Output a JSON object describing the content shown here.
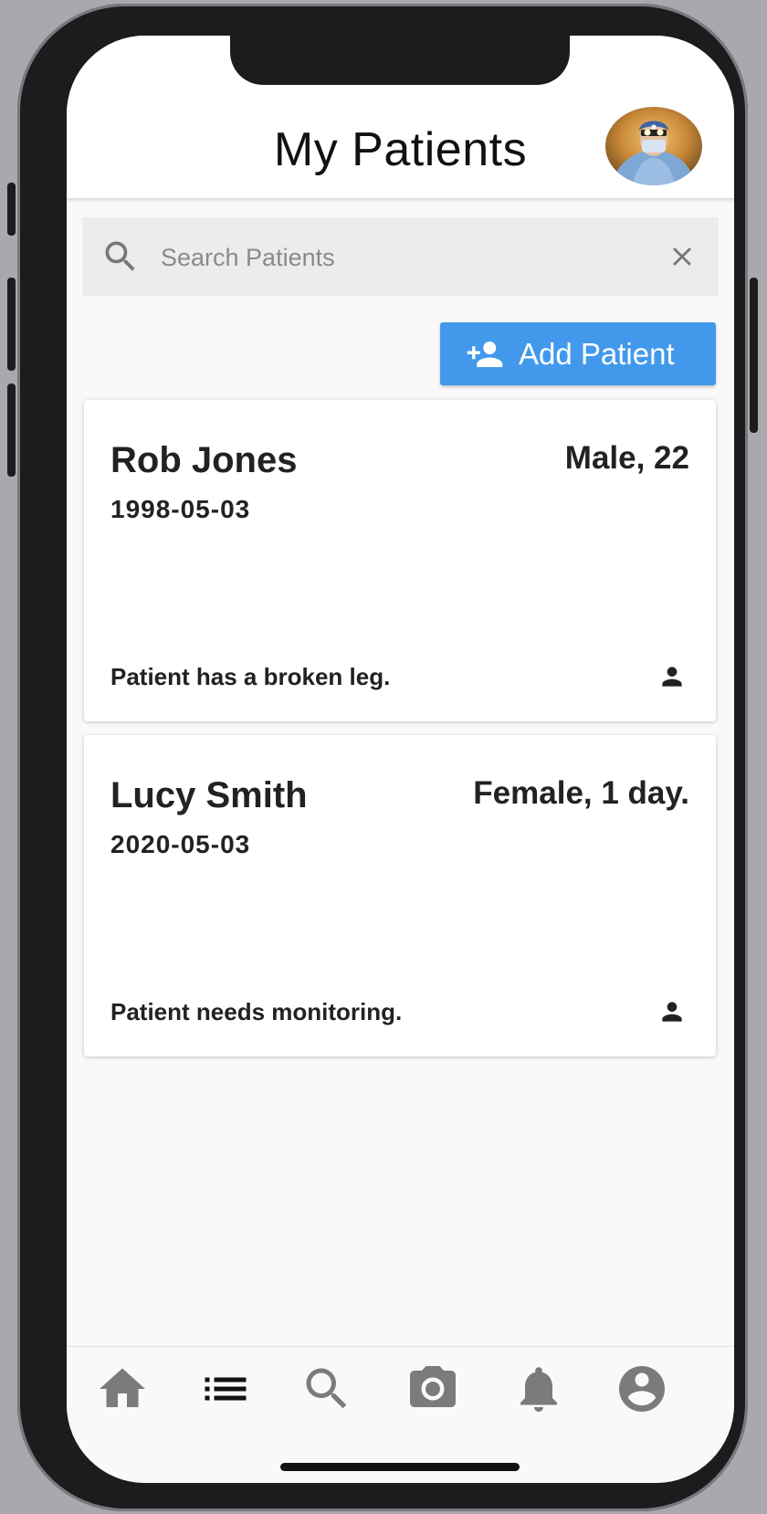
{
  "header": {
    "title": "My Patients"
  },
  "search": {
    "placeholder": "Search Patients",
    "value": ""
  },
  "actions": {
    "add_patient_label": "Add Patient"
  },
  "patients": [
    {
      "name": "Rob Jones",
      "gender_age": "Male, 22",
      "dob": "1998-05-03",
      "note": "Patient has a broken leg."
    },
    {
      "name": "Lucy Smith",
      "gender_age": "Female, 1 day.",
      "dob": "2020-05-03",
      "note": "Patient needs monitoring."
    }
  ],
  "nav": {
    "items": [
      {
        "icon": "home-icon",
        "active": false
      },
      {
        "icon": "list-icon",
        "active": true
      },
      {
        "icon": "search-icon",
        "active": false
      },
      {
        "icon": "camera-icon",
        "active": false
      },
      {
        "icon": "bell-icon",
        "active": false
      },
      {
        "icon": "account-icon",
        "active": false
      }
    ]
  },
  "colors": {
    "accent": "#4299ec",
    "nav_active": "#111111",
    "nav_inactive": "#7b7b7b"
  }
}
